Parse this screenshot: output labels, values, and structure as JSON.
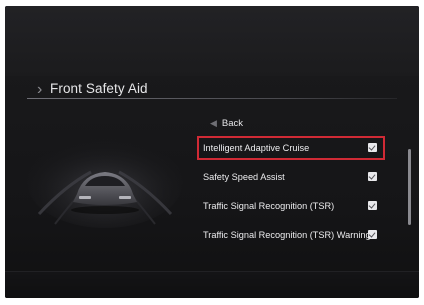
{
  "screen": {
    "title": "Front Safety Aid"
  },
  "menu": {
    "back_label": "Back",
    "items": [
      {
        "label": "Intelligent Adaptive Cruise",
        "checked": true,
        "selected": true
      },
      {
        "label": "Safety Speed Assist",
        "checked": true,
        "selected": false
      },
      {
        "label": "Traffic Signal Recognition (TSR)",
        "checked": true,
        "selected": false
      },
      {
        "label": "Traffic Signal Recognition (TSR) Warning",
        "checked": true,
        "selected": false
      }
    ]
  },
  "icons": {
    "title": "chevron-right-icon",
    "back": "chevron-left-icon",
    "checkbox": "checkbox-checked-icon",
    "car": "car-icon"
  },
  "colors": {
    "selection_outline": "#d02a35",
    "background": "#18181a",
    "text": "#ececee"
  }
}
